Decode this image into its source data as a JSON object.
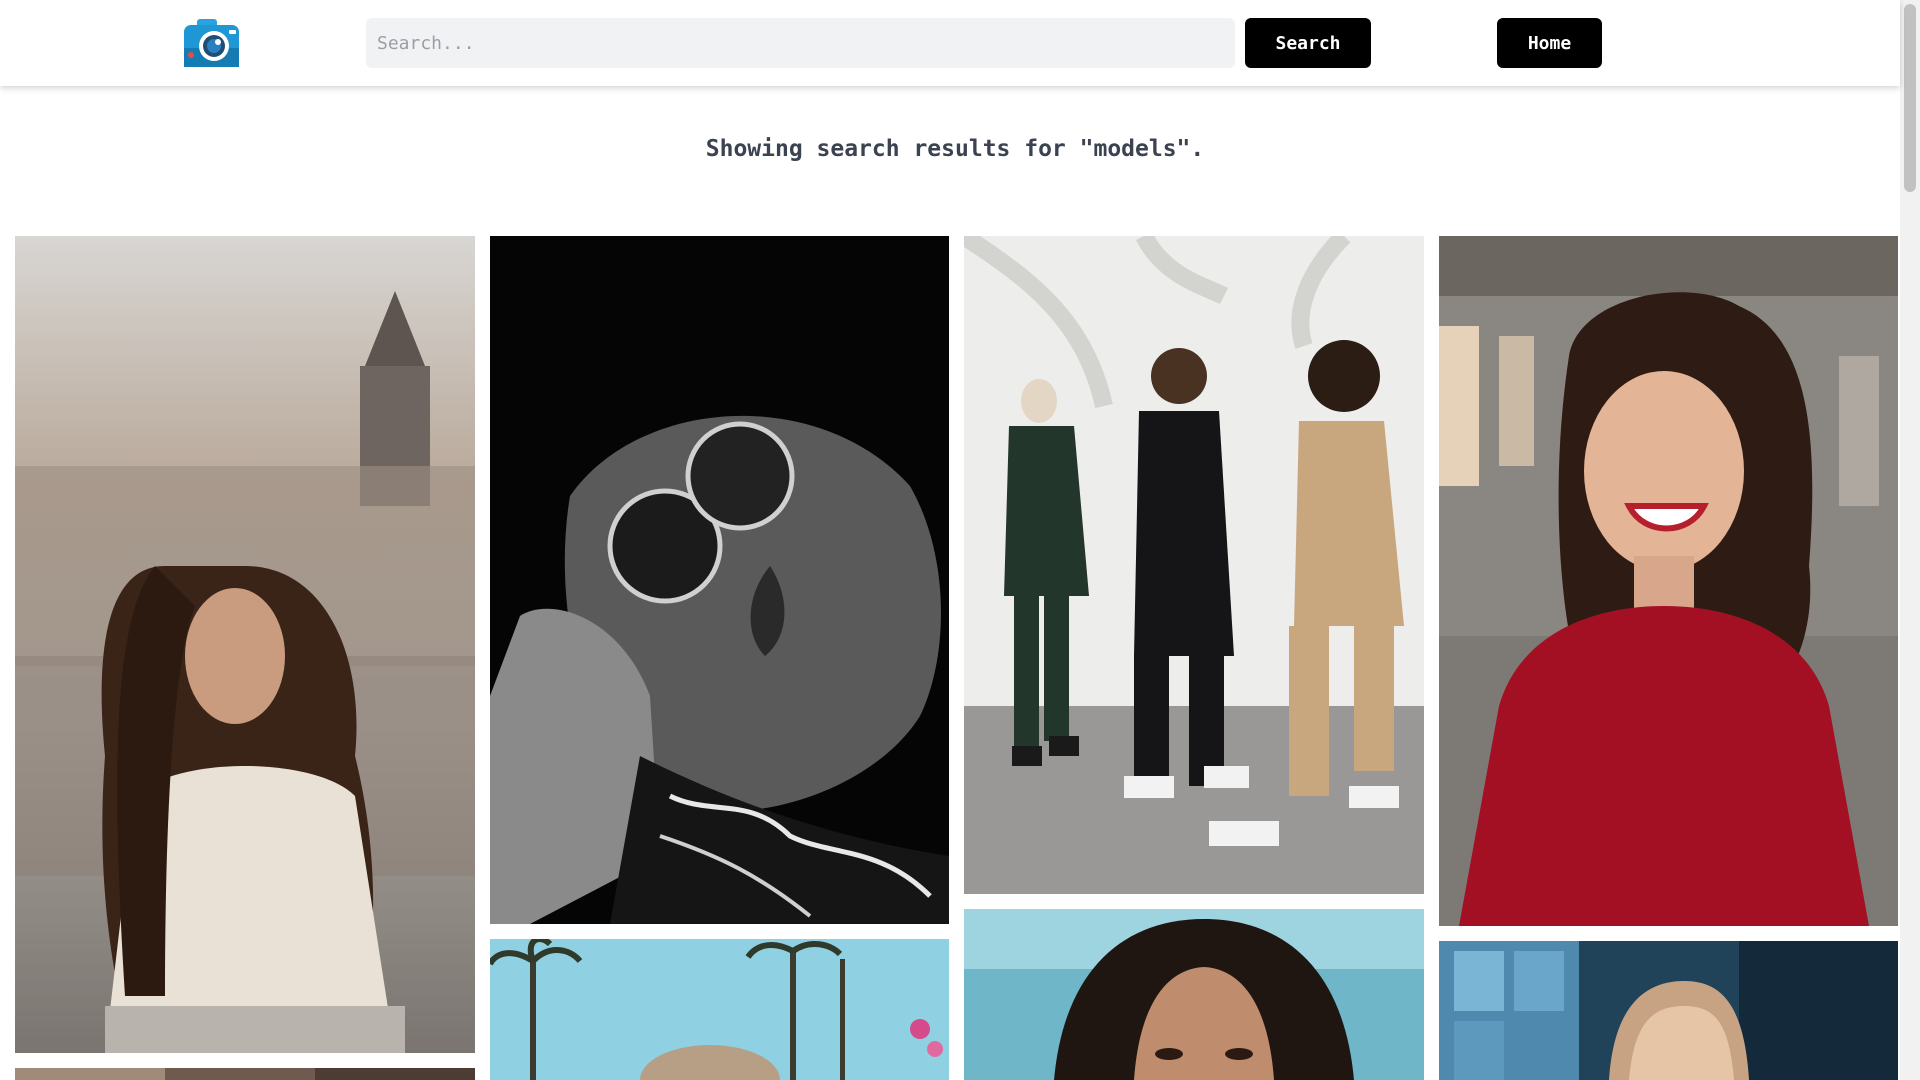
{
  "header": {
    "logo_icon": "camera-icon",
    "search": {
      "placeholder": "Search...",
      "value": ""
    },
    "search_button_label": "Search",
    "home_button_label": "Home"
  },
  "results": {
    "message": "Showing search results for \"models\"."
  },
  "gallery": {
    "columns": 4,
    "photos": [
      {
        "name": "photo-woman-long-hair-city",
        "subject": "woman with long brown hair, white blouse, city tower background"
      },
      {
        "name": "photo-sunglasses-black-white",
        "subject": "black and white portrait with round sunglasses"
      },
      {
        "name": "photo-three-models-walking",
        "subject": "three models walking by white wall"
      },
      {
        "name": "photo-smiling-woman-red-top",
        "subject": "smiling woman in red top"
      },
      {
        "name": "photo-woman-dark",
        "subject": "partially visible photo"
      },
      {
        "name": "photo-palm-trees-hat",
        "subject": "palm trees and sky with hat"
      },
      {
        "name": "photo-woman-dark-hair-blue",
        "subject": "woman with dark hair, blue background"
      },
      {
        "name": "photo-woman-blue-windows",
        "subject": "woman in front of blue windows"
      }
    ]
  },
  "colors": {
    "button_bg": "#000000",
    "search_bg": "#f1f2f4",
    "text": "#3b4250",
    "logo_blue": "#1f9ad6"
  }
}
